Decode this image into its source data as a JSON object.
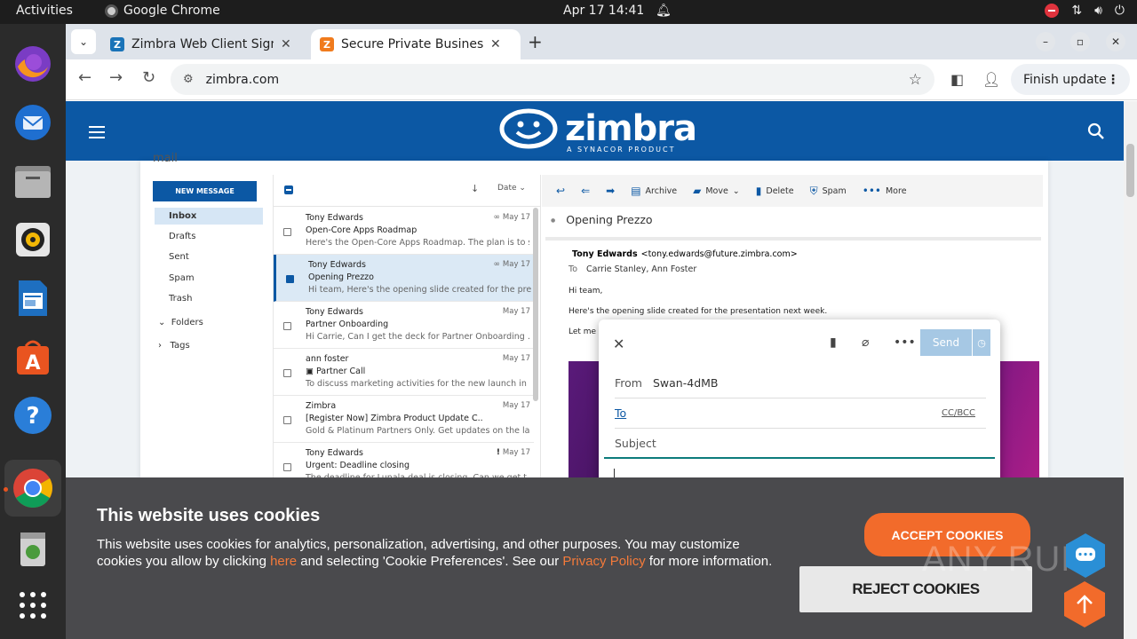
{
  "system": {
    "activities": "Activities",
    "app_name": "Google Chrome",
    "clock": "Apr 17  14:41"
  },
  "dock": {
    "items": [
      "firefox",
      "thunderbird",
      "files",
      "rhythmbox",
      "writer",
      "app-center",
      "help",
      "chrome",
      "trash",
      "app-grid"
    ]
  },
  "browser": {
    "tabs": [
      {
        "title": "Zimbra Web Client Sign I",
        "favicon": "Z",
        "active": false
      },
      {
        "title": "Secure Private Business",
        "favicon": "Z",
        "active": true
      }
    ],
    "url": "zimbra.com",
    "finish_update": "Finish update"
  },
  "site": {
    "logo_word": "zimbra",
    "logo_tag": "A SYNACOR PRODUCT"
  },
  "mail": {
    "section_label": "mail",
    "new_message": "NEW MESSAGE",
    "folders": [
      "Inbox",
      "Drafts",
      "Sent",
      "Spam",
      "Trash"
    ],
    "groups": [
      "Folders",
      "Tags"
    ],
    "list_sort": "Date",
    "messages": [
      {
        "from": "Tony Edwards",
        "subject": "Open-Core Apps Roadmap",
        "preview": "Here's the Open-Core Apps Roadmap. The plan is to s...",
        "date": "May 17",
        "selected": false
      },
      {
        "from": "Tony Edwards",
        "subject": "Opening Prezzo",
        "preview": "Hi team,     Here's the opening slide created for the pre...",
        "date": "May 17",
        "selected": true
      },
      {
        "from": "Tony Edwards",
        "subject": "Partner Onboarding",
        "preview": "Hi Carrie,     Can I get the deck for Partner Onboarding ...",
        "date": "May 17",
        "selected": false
      },
      {
        "from": "ann foster",
        "subject": "Partner Call",
        "preview": "To discuss marketing activities for the new launch in ...",
        "date": "May 17",
        "selected": false
      },
      {
        "from": "Zimbra",
        "subject": "[Register Now]  Zimbra Product Update C...",
        "preview": "Gold & Platinum Partners Only. Get updates on the lat...",
        "date": "May 17",
        "selected": false
      },
      {
        "from": "Tony Edwards",
        "subject": "Urgent: Deadline closing",
        "preview": "The deadline for Lunala deal is closing. Can we get t...",
        "date": "May 17",
        "selected": false
      }
    ],
    "reader_tools": [
      "Archive",
      "Move",
      "Delete",
      "Spam",
      "More"
    ],
    "conversation_title": "Opening Prezzo",
    "sender_name": "Tony Edwards",
    "sender_email": "<tony.edwards@future.zimbra.com>",
    "to_label": "To",
    "recipients": "Carrie Stanley,  Ann Foster",
    "body": [
      "Hi team,",
      "Here's the opening slide created for the presentation next week.",
      "Let me k"
    ],
    "compose": {
      "send": "Send",
      "from_label": "From",
      "from_value": "Swan-4dMB",
      "to_label": "To",
      "ccbcc": "CC/BCC",
      "subject_placeholder": "Subject"
    }
  },
  "cookie_banner": {
    "title": "This website uses cookies",
    "text_before": "This website uses cookies for analytics, personalization, advertising, and other purposes. You may customize cookies you allow by clicking ",
    "link_here": "here",
    "text_middle": " and selecting 'Cookie Preferences'. See our ",
    "link_privacy": "Privacy Policy",
    "text_after": " for more information.",
    "accept": "ACCEPT COOKIES",
    "reject": "REJECT COOKIES"
  },
  "watermark": "ANY RUN",
  "colors": {
    "zimbra_blue": "#0c58a4",
    "cookie_orange": "#f26b2b",
    "banner_bg": "#4a4a4d"
  }
}
